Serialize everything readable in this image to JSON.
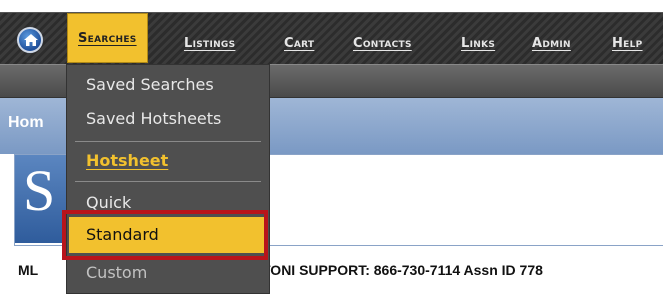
{
  "nav": {
    "menu": [
      {
        "label": "Searches"
      },
      {
        "label": "Listings"
      },
      {
        "label": "Cart"
      },
      {
        "label": "Contacts"
      },
      {
        "label": "Links"
      },
      {
        "label": "Admin"
      },
      {
        "label": "Help"
      }
    ]
  },
  "page": {
    "heading": "Hom",
    "logo_letter": "S"
  },
  "dropdown": {
    "items": [
      {
        "label": "Saved Searches"
      },
      {
        "label": "Saved Hotsheets"
      },
      {
        "label": "Hotsheet"
      },
      {
        "label": "Quick"
      },
      {
        "label": "Standard"
      },
      {
        "label": "Custom"
      }
    ]
  },
  "footer": {
    "support_left": "ML",
    "support_right": "TONI SUPPORT: 866-730-7114 Assn ID 778"
  },
  "colors": {
    "accent": "#f2c12e",
    "highlight": "#b8141b"
  }
}
